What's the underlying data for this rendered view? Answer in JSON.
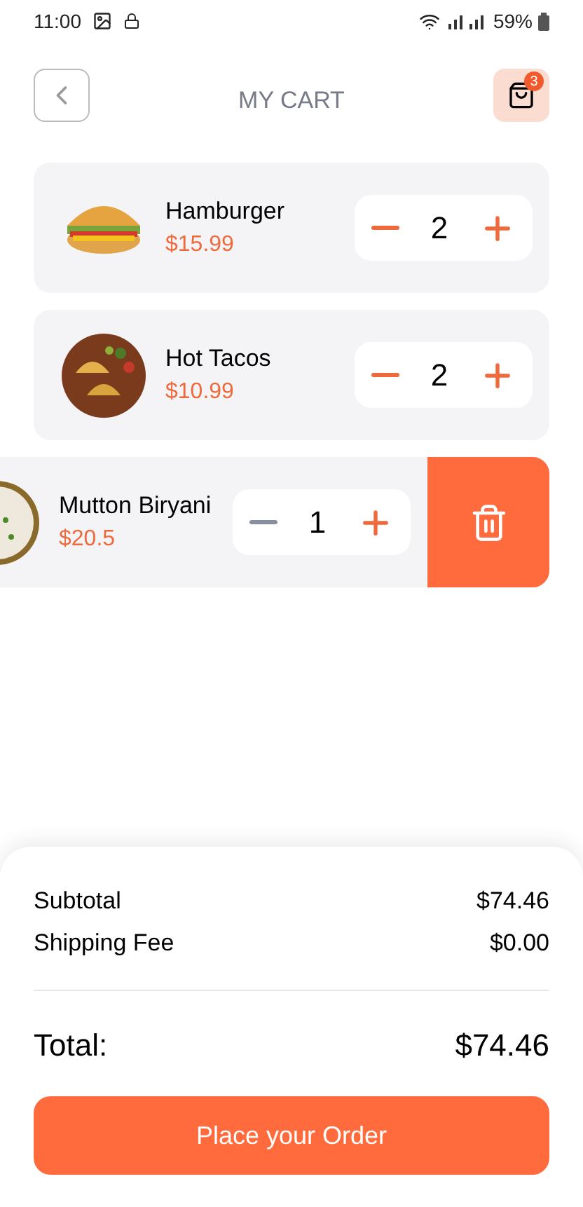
{
  "status_bar": {
    "time": "11:00",
    "battery": "59%"
  },
  "header": {
    "title": "MY CART",
    "cart_count": "3"
  },
  "items": [
    {
      "name": "Hamburger",
      "price": "$15.99",
      "quantity": "2",
      "minus_disabled": false,
      "swiped": false
    },
    {
      "name": "Hot Tacos",
      "price": "$10.99",
      "quantity": "2",
      "minus_disabled": false,
      "swiped": false
    },
    {
      "name": "Mutton Biryani",
      "price": "$20.5",
      "quantity": "1",
      "minus_disabled": true,
      "swiped": true
    }
  ],
  "summary": {
    "rows": [
      {
        "label": "Subtotal",
        "value": "$74.46"
      },
      {
        "label": "Shipping Fee",
        "value": "$0.00"
      }
    ],
    "total_label": "Total:",
    "total_value": "$74.46"
  },
  "order_button": "Place your Order"
}
